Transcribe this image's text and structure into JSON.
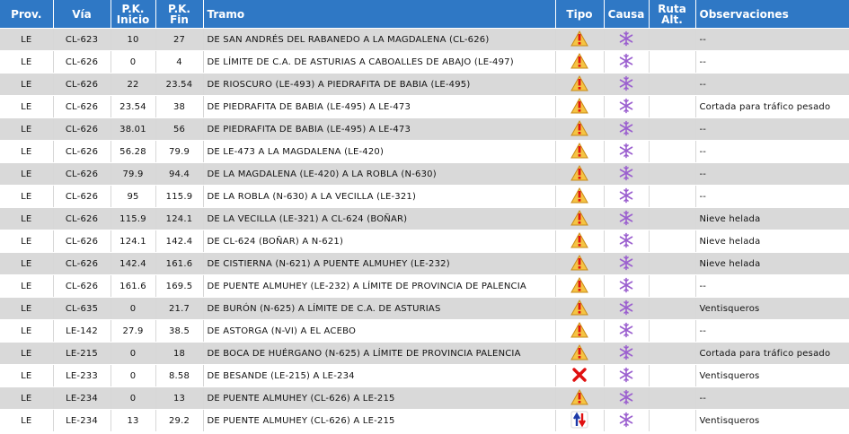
{
  "header": {
    "prov": "Prov.",
    "via": "Vía",
    "pk_inicio": "P.K. Inicio",
    "pk_fin": "P.K. Fin",
    "tramo": "Tramo",
    "tipo": "Tipo",
    "causa": "Causa",
    "ruta_alt": "Ruta Alt.",
    "observaciones": "Observaciones"
  },
  "icons": {
    "warning": "warning-icon",
    "closed": "closed-x-icon",
    "two_way": "two-way-traffic-icon",
    "snow": "snowflake-icon"
  },
  "colors": {
    "header_bg": "#2f78c5",
    "row_alt": "#d9d9d9",
    "warning_fill": "#f5c443",
    "alert_red": "#e01010",
    "snow_purple": "#9b5fcf"
  },
  "rows": [
    {
      "prov": "LE",
      "via": "CL-623",
      "pk_inicio": "10",
      "pk_fin": "27",
      "tramo": "DE SAN ANDRÉS DEL RABANEDO A LA MAGDALENA (CL-626)",
      "tipo": "warning",
      "causa": "snow",
      "ruta_alt": "",
      "obs": "--"
    },
    {
      "prov": "LE",
      "via": "CL-626",
      "pk_inicio": "0",
      "pk_fin": "4",
      "tramo": "DE LÍMITE DE C.A. DE ASTURIAS A CABOALLES DE ABAJO (LE-497)",
      "tipo": "warning",
      "causa": "snow",
      "ruta_alt": "",
      "obs": "--"
    },
    {
      "prov": "LE",
      "via": "CL-626",
      "pk_inicio": "22",
      "pk_fin": "23.54",
      "tramo": "DE RIOSCURO (LE-493) A PIEDRAFITA DE BABIA (LE-495)",
      "tipo": "warning",
      "causa": "snow",
      "ruta_alt": "",
      "obs": "--"
    },
    {
      "prov": "LE",
      "via": "CL-626",
      "pk_inicio": "23.54",
      "pk_fin": "38",
      "tramo": "DE PIEDRAFITA DE BABIA (LE-495) A LE-473",
      "tipo": "warning",
      "causa": "snow",
      "ruta_alt": "",
      "obs": "Cortada para tráfico pesado"
    },
    {
      "prov": "LE",
      "via": "CL-626",
      "pk_inicio": "38.01",
      "pk_fin": "56",
      "tramo": "DE PIEDRAFITA DE BABIA (LE-495) A LE-473",
      "tipo": "warning",
      "causa": "snow",
      "ruta_alt": "",
      "obs": "--"
    },
    {
      "prov": "LE",
      "via": "CL-626",
      "pk_inicio": "56.28",
      "pk_fin": "79.9",
      "tramo": "DE LE-473 A LA MAGDALENA (LE-420)",
      "tipo": "warning",
      "causa": "snow",
      "ruta_alt": "",
      "obs": "--"
    },
    {
      "prov": "LE",
      "via": "CL-626",
      "pk_inicio": "79.9",
      "pk_fin": "94.4",
      "tramo": "DE LA MAGDALENA (LE-420) A LA ROBLA (N-630)",
      "tipo": "warning",
      "causa": "snow",
      "ruta_alt": "",
      "obs": "--"
    },
    {
      "prov": "LE",
      "via": "CL-626",
      "pk_inicio": "95",
      "pk_fin": "115.9",
      "tramo": "DE LA ROBLA (N-630) A LA VECILLA (LE-321)",
      "tipo": "warning",
      "causa": "snow",
      "ruta_alt": "",
      "obs": "--"
    },
    {
      "prov": "LE",
      "via": "CL-626",
      "pk_inicio": "115.9",
      "pk_fin": "124.1",
      "tramo": "DE LA VECILLA (LE-321) A CL-624 (BOÑAR)",
      "tipo": "warning",
      "causa": "snow",
      "ruta_alt": "",
      "obs": "Nieve helada"
    },
    {
      "prov": "LE",
      "via": "CL-626",
      "pk_inicio": "124.1",
      "pk_fin": "142.4",
      "tramo": "DE CL-624 (BOÑAR) A N-621)",
      "tipo": "warning",
      "causa": "snow",
      "ruta_alt": "",
      "obs": "Nieve helada"
    },
    {
      "prov": "LE",
      "via": "CL-626",
      "pk_inicio": "142.4",
      "pk_fin": "161.6",
      "tramo": "DE CISTIERNA (N-621) A PUENTE ALMUHEY (LE-232)",
      "tipo": "warning",
      "causa": "snow",
      "ruta_alt": "",
      "obs": "Nieve helada"
    },
    {
      "prov": "LE",
      "via": "CL-626",
      "pk_inicio": "161.6",
      "pk_fin": "169.5",
      "tramo": "DE PUENTE ALMUHEY (LE-232) A LÍMITE DE PROVINCIA DE PALENCIA",
      "tipo": "warning",
      "causa": "snow",
      "ruta_alt": "",
      "obs": "--"
    },
    {
      "prov": "LE",
      "via": "CL-635",
      "pk_inicio": "0",
      "pk_fin": "21.7",
      "tramo": "DE BURÓN (N-625) A LÍMITE DE C.A. DE ASTURIAS",
      "tipo": "warning",
      "causa": "snow",
      "ruta_alt": "",
      "obs": "Ventisqueros"
    },
    {
      "prov": "LE",
      "via": "LE-142",
      "pk_inicio": "27.9",
      "pk_fin": "38.5",
      "tramo": "DE ASTORGA (N-VI) A EL ACEBO",
      "tipo": "warning",
      "causa": "snow",
      "ruta_alt": "",
      "obs": "--"
    },
    {
      "prov": "LE",
      "via": "LE-215",
      "pk_inicio": "0",
      "pk_fin": "18",
      "tramo": "DE BOCA DE HUÉRGANO (N-625) A LÍMITE DE PROVINCIA PALENCIA",
      "tipo": "warning",
      "causa": "snow",
      "ruta_alt": "",
      "obs": "Cortada para tráfico pesado"
    },
    {
      "prov": "LE",
      "via": "LE-233",
      "pk_inicio": "0",
      "pk_fin": "8.58",
      "tramo": "DE BESANDE (LE-215) A LE-234",
      "tipo": "closed",
      "causa": "snow",
      "ruta_alt": "",
      "obs": "Ventisqueros"
    },
    {
      "prov": "LE",
      "via": "LE-234",
      "pk_inicio": "0",
      "pk_fin": "13",
      "tramo": "DE PUENTE ALMUHEY (CL-626) A LE-215",
      "tipo": "warning",
      "causa": "snow",
      "ruta_alt": "",
      "obs": "--"
    },
    {
      "prov": "LE",
      "via": "LE-234",
      "pk_inicio": "13",
      "pk_fin": "29.2",
      "tramo": "DE PUENTE ALMUHEY (CL-626) A LE-215",
      "tipo": "two_way",
      "causa": "snow",
      "ruta_alt": "",
      "obs": "Ventisqueros"
    }
  ]
}
